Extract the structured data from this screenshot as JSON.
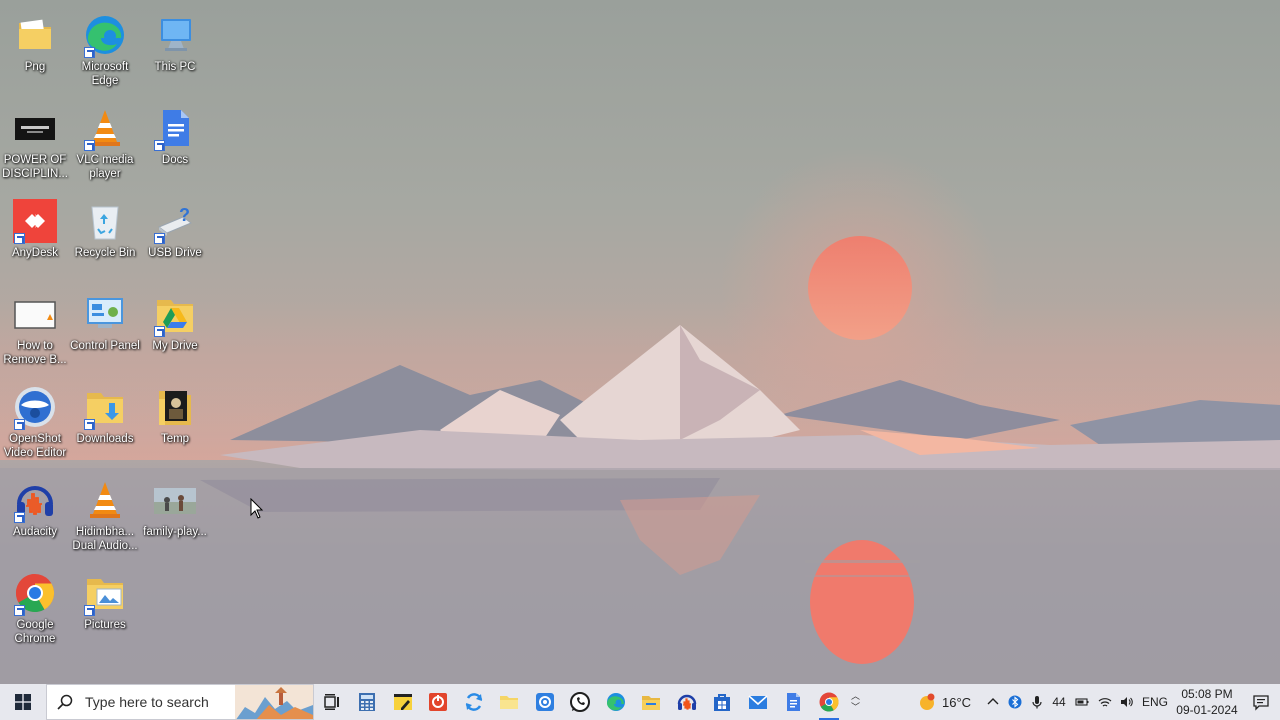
{
  "desktop": {
    "icons": [
      {
        "label": "Png",
        "icon": "folder-icon"
      },
      {
        "label": "Microsoft Edge",
        "icon": "edge-icon"
      },
      {
        "label": "This PC",
        "icon": "computer-icon"
      },
      {
        "label": "POWER OF DISCIPLIN...",
        "icon": "video-thumbnail-icon"
      },
      {
        "label": "VLC media player",
        "icon": "vlc-icon"
      },
      {
        "label": "Docs",
        "icon": "google-docs-icon"
      },
      {
        "label": "AnyDesk",
        "icon": "anydesk-icon"
      },
      {
        "label": "Recycle Bin",
        "icon": "recycle-bin-icon"
      },
      {
        "label": "USB Drive",
        "icon": "usb-drive-icon"
      },
      {
        "label": "How to Remove B...",
        "icon": "video-thumbnail-icon"
      },
      {
        "label": "Control Panel",
        "icon": "control-panel-icon"
      },
      {
        "label": "My Drive",
        "icon": "google-drive-folder-icon"
      },
      {
        "label": "OpenShot Video Editor",
        "icon": "openshot-icon"
      },
      {
        "label": "Downloads",
        "icon": "downloads-folder-icon"
      },
      {
        "label": "Temp",
        "icon": "folder-icon"
      },
      {
        "label": "Audacity",
        "icon": "audacity-icon"
      },
      {
        "label": "Hidimbha... Dual Audio...",
        "icon": "vlc-icon"
      },
      {
        "label": "family-play...",
        "icon": "image-thumbnail-icon"
      },
      {
        "label": "Google Chrome",
        "icon": "chrome-icon"
      },
      {
        "label": "Pictures",
        "icon": "pictures-folder-icon"
      }
    ]
  },
  "taskbar": {
    "search_placeholder": "Type here to search",
    "pinned": [
      {
        "name": "task-view",
        "icon": "task-view-icon"
      },
      {
        "name": "calculator",
        "icon": "calculator-icon"
      },
      {
        "name": "sticky-notes",
        "icon": "sticky-notes-icon"
      },
      {
        "name": "office",
        "icon": "office-icon"
      },
      {
        "name": "sync",
        "icon": "sync-icon"
      },
      {
        "name": "file-explorer-yellow",
        "icon": "folder-icon"
      },
      {
        "name": "screen-recorder",
        "icon": "record-icon"
      },
      {
        "name": "whatsapp",
        "icon": "whatsapp-icon"
      },
      {
        "name": "edge",
        "icon": "edge-icon"
      },
      {
        "name": "file-explorer",
        "icon": "file-explorer-icon"
      },
      {
        "name": "audacity",
        "icon": "audacity-icon"
      },
      {
        "name": "store",
        "icon": "store-icon"
      },
      {
        "name": "mail",
        "icon": "mail-icon"
      },
      {
        "name": "docs",
        "icon": "google-docs-icon"
      },
      {
        "name": "chrome",
        "icon": "chrome-icon"
      }
    ],
    "weather": {
      "temp": "16°C",
      "icon": "weather-sun-icon"
    },
    "tray": {
      "volume_level": "44",
      "language": "ENG",
      "time": "05:08 PM",
      "date": "09-01-2024"
    }
  },
  "colors": {
    "taskbar_bg": "#e7e8ee",
    "sun": "#ef8a78",
    "accent": "#2b6fe0"
  }
}
